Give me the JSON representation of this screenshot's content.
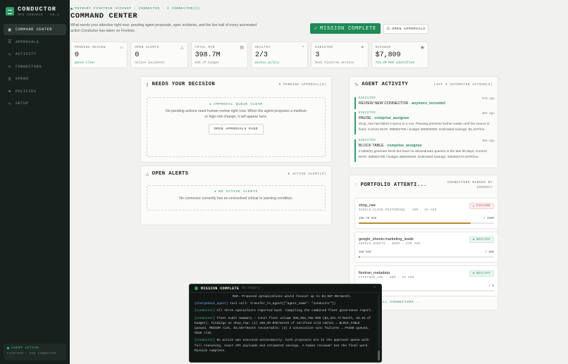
{
  "brand": {
    "name": "CONDUCTOR",
    "sub": "OPS CONSOLE · V0.1"
  },
  "nav": [
    {
      "label": "COMMAND CENTER",
      "icon": "grid-icon"
    },
    {
      "label": "APPROVALS",
      "icon": "check-list-icon"
    },
    {
      "label": "ACTIVITY",
      "icon": "pulse-icon"
    },
    {
      "label": "CONNECTORS",
      "icon": "link-icon"
    },
    {
      "label": "SPEND",
      "icon": "dollar-icon"
    },
    {
      "label": "POLICIES",
      "icon": "shield-icon"
    },
    {
      "label": "SETUP",
      "icon": "wrench-icon"
    }
  ],
  "agent": {
    "status": "AGENT ACTIVE",
    "sub": "FIVETRAN · SDK CONNECTED"
  },
  "header": {
    "eyebrow": "PRIMARY FIVETRAN ACCOUNT · CONNECTED · 3 CONNECTOR(S)",
    "title": "COMMAND CENTER",
    "description": "What needs your attention right now: pending agent proposals, open incidents, and the live trail of every automated action Conductor has taken on Fivetran.",
    "complete_label": "MISSION COMPLETE",
    "approvals_label": "OPEN APPROVALS"
  },
  "stats": [
    {
      "label": "PENDING REVIEW",
      "value": "0",
      "sub": "Queue clear",
      "sub_green": true,
      "icon": "inbox-icon",
      "glyph": "▭"
    },
    {
      "label": "OPEN ALERTS",
      "value": "0",
      "sub": "Active incidents",
      "sub_green": false,
      "icon": "warning-icon",
      "glyph": "△"
    },
    {
      "label": "TOTAL MAR",
      "value": "398.7M",
      "sub": "83% of budget",
      "sub_green": false,
      "icon": "database-icon",
      "glyph": "▤"
    },
    {
      "label": "HEALTHY",
      "value": "2/3",
      "sub": "Within policy",
      "sub_green": true,
      "icon": "heart-icon",
      "glyph": "◔"
    },
    {
      "label": "EXECUTED",
      "value": "3",
      "sub": "Real Fivetran actions",
      "sub_green": false,
      "icon": "spark-icon",
      "glyph": "✦"
    },
    {
      "label": "SAVINGS",
      "value": "$7,809",
      "sub": "733.3M MAR identified",
      "sub_green": true,
      "icon": "coin-icon",
      "glyph": "◉"
    }
  ],
  "decision": {
    "title": "NEEDS YOUR DECISION",
    "meta": "0 PENDING APPROVAL(S)",
    "empty_title": "APPROVAL QUEUE CLEAR",
    "empty_text": "No pending actions need human review right now. When the agent proposes a medium or high-risk change, it will appear here.",
    "button": "OPEN APPROVALS PAGE"
  },
  "alerts": {
    "title": "OPEN ALERTS",
    "meta": "0 ACTIVE ALERT(S)",
    "empty_title": "NO ACTIVE ALERTS",
    "empty_text": "No connector currently has an unresolved critical or warning condition."
  },
  "activity": {
    "title": "AGENT ACTIVITY",
    "meta": "LAST 3 AUTOMATED ACTION(S)",
    "items": [
      {
        "badge": "EXECUTED",
        "time": "37m ago",
        "action": "REVIEW NEW CONNECTOR",
        "target": "anymore_recruited",
        "text": ""
      },
      {
        "badge": "EXECUTED",
        "time": "40m ago",
        "action": "PAUSE",
        "target": "comprise_assignee",
        "text": "shop_raw has failed 3 syncs in a row. Pausing prevents further waste until the source is fixed. Current MAR: 398662795 / budget 480000000. Estimated savings: $1,347/mo."
      },
      {
        "badge": "EXECUTED",
        "time": "40m ago",
        "action": "BLOCK TABLE",
        "target": "comprise_assignee",
        "text": "2 table(s) generate MAR but have no downstream queries in the last 30 days. Current MAR: 398662795 / budget 480000000. Estimated savings: 335294170 MAR/mo."
      }
    ]
  },
  "portfolio": {
    "title": "PORTFOLIO ATTENTI...",
    "meta": "CONNECTORS RANKED BY URGENCY",
    "connectors": [
      {
        "name": "shop_raw",
        "meta": "GOOGLE_CLOUD_POSTGRESQL · 15M · 4H AGO",
        "status": "FAILURE",
        "ok": false,
        "mar": "398.7M MAR",
        "cap": "/ 480M",
        "fill": 0.83
      },
      {
        "name": "google_sheets.marketing_leads",
        "meta": "GOOGLE_SHEETS · 360M · 23M AGO",
        "status": "HEALTHY",
        "ok": true,
        "mar": "400 MAR",
        "cap": "/ 50K",
        "fill": 0.01
      },
      {
        "name": "fivetran_metadata",
        "meta": "FIVETRAN_LOG · 60M · 1H AGO",
        "status": "HEALTHY",
        "ok": true,
        "mar": "",
        "cap": "/ 0",
        "fill": 0
      }
    ],
    "all_link": "ALL CONNECTORS →"
  },
  "terminal": {
    "title": "MISSION COMPLETE",
    "steps": "63 step(s)",
    "lines": [
      {
        "src": "",
        "text": "MAR. Proposed optimizations would recover up to $3,567.00/month."
      },
      {
        "src": "[chargeback_agent]",
        "src_blue": true,
        "text": "tool call: transfer_to_agent({\"agent_name\": \"conductor\"})"
      },
      {
        "src": "[conductor]",
        "src_blue": false,
        "text": "All three specialists reported back. Compiling the combined fleet governance report."
      },
      {
        "src": "[conductor]",
        "src_blue": false,
        "text": "Fleet Audit Summary — total fleet volume 398,662,795 MAR ($4,241.77/month, 83.1% of budget). Findings on shop_raw: (1) 335.2M MAR/month of verified cold tables → BLOCK_TABLE queued, MEDIUM risk, $3,567/month recoverable; (2) 3 consecutive sync failures → PAUSE queued, HIGH risk."
      },
      {
        "src": "[conductor]",
        "src_blue": false,
        "text": "No action was executed autonomously: both proposals are in the approval queue with full reasoning, exact API payloads and estimated savings. A human reviewer has the final word. Mission complete."
      }
    ]
  }
}
